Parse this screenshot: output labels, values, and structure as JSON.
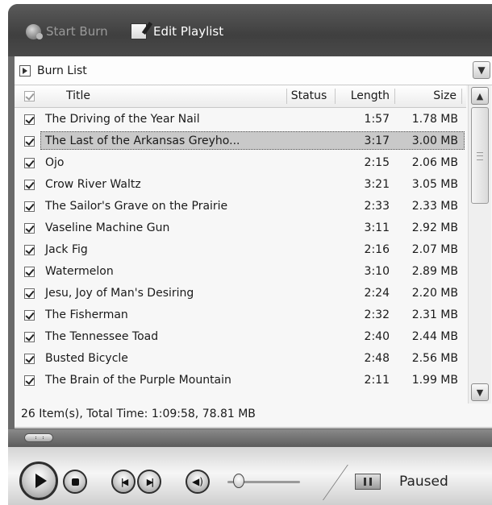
{
  "toolbar": {
    "start_burn_label": "Start Burn",
    "edit_playlist_label": "Edit Playlist"
  },
  "burn_list": {
    "label": "Burn List",
    "icons": {
      "list": "play-square-icon",
      "dropdown": "chevron-down-icon"
    }
  },
  "columns": {
    "title": "Title",
    "status": "Status",
    "length": "Length",
    "size": "Size"
  },
  "tracks": [
    {
      "title": "The Driving of the Year Nail",
      "length": "1:57",
      "size": "1.78 MB",
      "checked": true
    },
    {
      "title": "The Last of the Arkansas Greyho...",
      "length": "3:17",
      "size": "3.00 MB",
      "checked": true,
      "selected": true
    },
    {
      "title": "Ojo",
      "length": "2:15",
      "size": "2.06 MB",
      "checked": true
    },
    {
      "title": "Crow River Waltz",
      "length": "3:21",
      "size": "3.05 MB",
      "checked": true
    },
    {
      "title": "The Sailor's Grave on the Prairie",
      "length": "2:33",
      "size": "2.33 MB",
      "checked": true
    },
    {
      "title": "Vaseline Machine Gun",
      "length": "3:11",
      "size": "2.92 MB",
      "checked": true
    },
    {
      "title": "Jack Fig",
      "length": "2:16",
      "size": "2.07 MB",
      "checked": true
    },
    {
      "title": "Watermelon",
      "length": "3:10",
      "size": "2.89 MB",
      "checked": true
    },
    {
      "title": "Jesu, Joy of Man's Desiring",
      "length": "2:24",
      "size": "2.20 MB",
      "checked": true
    },
    {
      "title": "The Fisherman",
      "length": "2:32",
      "size": "2.31 MB",
      "checked": true
    },
    {
      "title": "The Tennessee Toad",
      "length": "2:40",
      "size": "2.44 MB",
      "checked": true
    },
    {
      "title": "Busted Bicycle",
      "length": "2:48",
      "size": "2.56 MB",
      "checked": true
    },
    {
      "title": "The Brain of the Purple Mountain",
      "length": "2:11",
      "size": "1.99 MB",
      "checked": true
    }
  ],
  "summary": "26 Item(s), Total Time: 1:09:58, 78.81 MB",
  "player": {
    "status": "Paused",
    "volume_fraction": 0.15,
    "icons": {
      "play": "play-icon",
      "stop": "stop-icon",
      "previous": "previous-track-icon",
      "next": "next-track-icon",
      "mute": "speaker-icon",
      "pause": "pause-icon"
    }
  },
  "colors": {
    "toolbar_bg": "#4a4a4a",
    "selected_row": "#c9c9c9",
    "panel_bg": "#f7f7f7"
  }
}
